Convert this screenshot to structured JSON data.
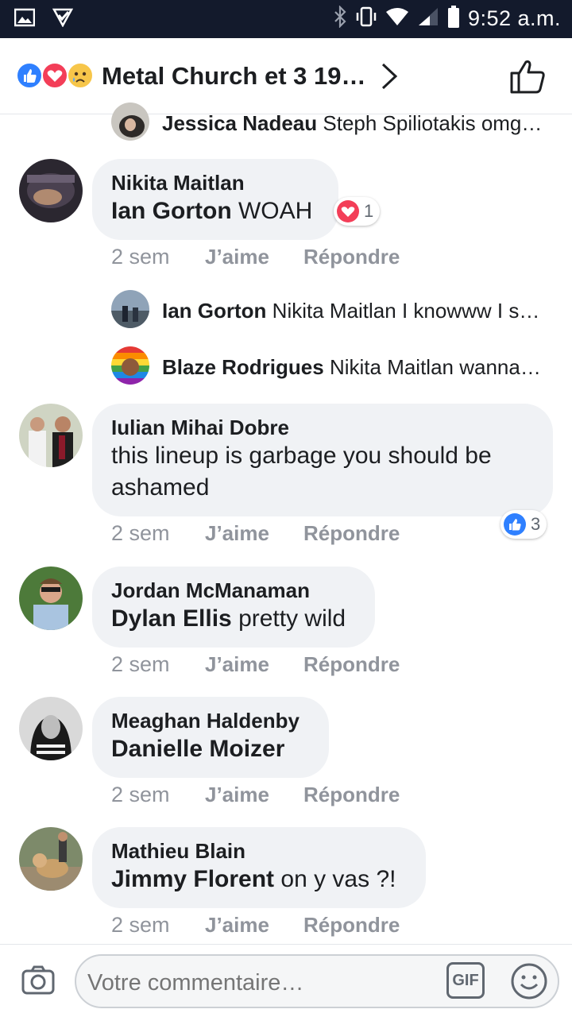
{
  "status_bar": {
    "time": "9:52 a.m."
  },
  "header": {
    "title": "Metal Church et 3 19…",
    "reaction_icons": [
      "like-icon",
      "love-icon",
      "sad-icon"
    ]
  },
  "comments": [
    {
      "type": "reply",
      "author": "Jessica Nadeau",
      "text": "Steph Spiliotakis  omg…"
    },
    {
      "type": "comment",
      "author": "Nikita Maitlan",
      "mention": "Ian Gorton",
      "text": " WOAH",
      "time": "2 sem",
      "like": "J’aime",
      "reply": "Répondre",
      "reaction": {
        "icon": "love-icon",
        "count": "1"
      }
    },
    {
      "type": "reply",
      "author": "Ian Gorton",
      "text": "Nikita Maitlan I knowww I sa…"
    },
    {
      "type": "reply",
      "author": "Blaze Rodrigues",
      "text": "Nikita Maitlan wanna …"
    },
    {
      "type": "comment",
      "author": "Iulian Mihai Dobre",
      "text_line1": "this lineup is garbage you should be",
      "text_line2": "ashamed",
      "time": "2 sem",
      "like": "J’aime",
      "reply": "Répondre",
      "reaction": {
        "icon": "like-icon",
        "count": "3"
      }
    },
    {
      "type": "comment",
      "author": "Jordan McManaman",
      "mention": "Dylan Ellis",
      "text": " pretty wild",
      "time": "2 sem",
      "like": "J’aime",
      "reply": "Répondre"
    },
    {
      "type": "comment",
      "author": "Meaghan Haldenby",
      "mention": "Danielle Moizer",
      "text": "",
      "time": "2 sem",
      "like": "J’aime",
      "reply": "Répondre"
    },
    {
      "type": "comment",
      "author": "Mathieu Blain",
      "mention": "Jimmy Florent",
      "text": " on y vas ?!",
      "time": "2 sem",
      "like": "J’aime",
      "reply": "Répondre"
    }
  ],
  "composer": {
    "placeholder": "Votre commentaire…",
    "gif_label": "GIF"
  },
  "colors": {
    "status_bar": "#131a2c",
    "bubble": "#f0f2f5",
    "like_blue": "#2f80ff",
    "love_red": "#f33e58",
    "meta_gray": "#90949c"
  }
}
